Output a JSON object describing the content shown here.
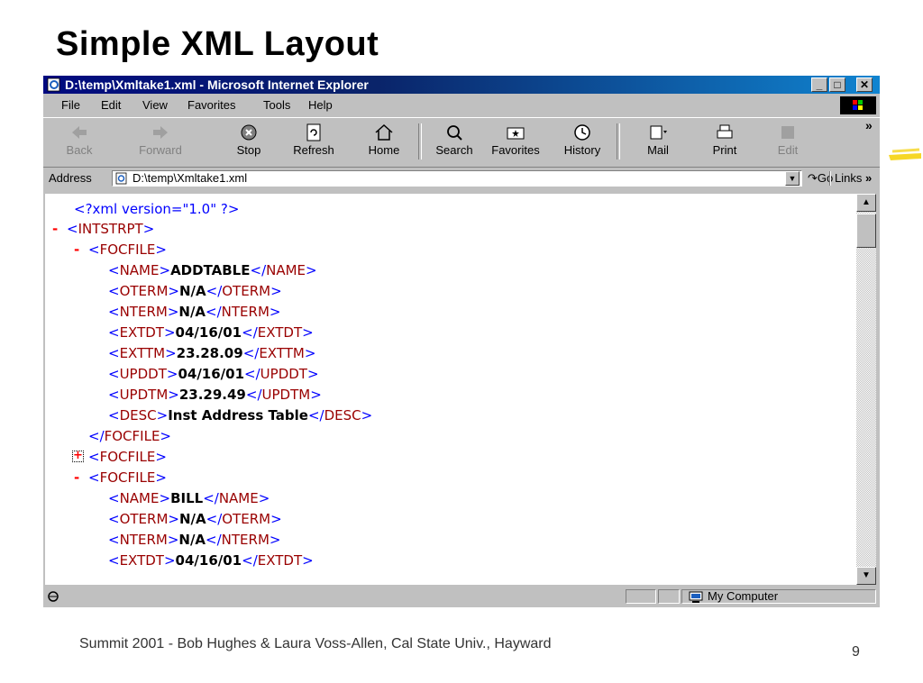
{
  "slide": {
    "title": "Simple XML Layout",
    "footer": "Summit 2001 - Bob Hughes & Laura Voss-Allen, Cal State Univ., Hayward",
    "page_number": "9"
  },
  "window": {
    "title": "D:\\temp\\Xmltake1.xml - Microsoft Internet Explorer",
    "controls": [
      "_",
      "□",
      "✕"
    ]
  },
  "menu": [
    "File",
    "Edit",
    "View",
    "Favorites",
    "Tools",
    "Help"
  ],
  "toolbar": {
    "back": "Back",
    "forward": "Forward",
    "stop": "Stop",
    "refresh": "Refresh",
    "home": "Home",
    "search": "Search",
    "favorites": "Favorites",
    "history": "History",
    "mail": "Mail",
    "print": "Print",
    "edit": "Edit",
    "chevron": "»"
  },
  "address": {
    "label": "Address",
    "value": "D:\\temp\\Xmltake1.xml",
    "go": "Go",
    "links": "Links"
  },
  "xml": {
    "declaration": "<?xml version=\"1.0\" ?>",
    "root": "INTSTRPT",
    "focfile": "FOCFILE",
    "record1": {
      "NAME": "ADDTABLE",
      "OTERM": "N/A",
      "NTERM": "N/A",
      "EXTDT": "04/16/01",
      "EXTTM": "23.28.09",
      "UPDDT": "04/16/01",
      "UPDTM": "23.29.49",
      "DESC": "Inst Address Table"
    },
    "record3": {
      "NAME": "BILL",
      "OTERM": "N/A",
      "NTERM": "N/A",
      "EXTDT": "04/16/01"
    }
  },
  "status": {
    "zone": "My Computer"
  }
}
